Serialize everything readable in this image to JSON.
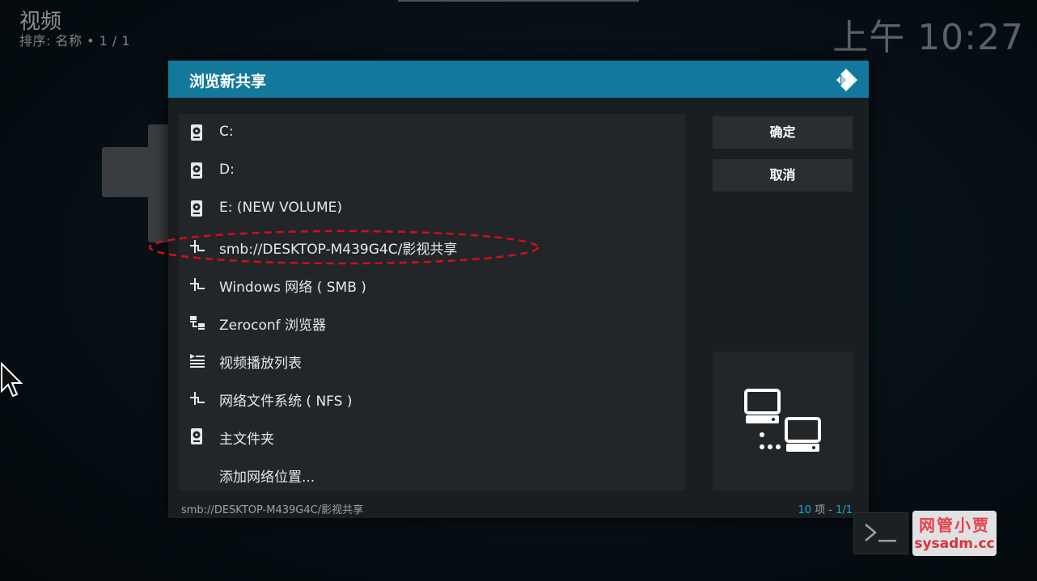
{
  "background": {
    "title": "视频",
    "subtitle": "排序: 名称  •  1 / 1",
    "clock": "上午 10:27"
  },
  "dialog": {
    "title": "浏览新共享",
    "logo_icon": "kodi-logo-icon",
    "items": [
      {
        "label": "C:",
        "icon": "harddisk-icon"
      },
      {
        "label": "D:",
        "icon": "harddisk-icon"
      },
      {
        "label": "E: (NEW VOLUME)",
        "icon": "harddisk-icon"
      },
      {
        "label": "smb://DESKTOP-M439G4C/影视共享",
        "icon": "network-icon"
      },
      {
        "label": "Windows 网络 ( SMB )",
        "icon": "network-icon"
      },
      {
        "label": "Zeroconf 浏览器",
        "icon": "network-share-icon"
      },
      {
        "label": "视频播放列表",
        "icon": "playlist-icon"
      },
      {
        "label": "网络文件系统 ( NFS )",
        "icon": "network-icon"
      },
      {
        "label": "主文件夹",
        "icon": "harddisk-icon"
      },
      {
        "label": "添加网络位置...",
        "icon": ""
      }
    ],
    "ok_label": "确定",
    "cancel_label": "取消",
    "status_path": "smb://DESKTOP-M439G4C/影视共享",
    "status_count": "10",
    "status_items_word": " 项 - ",
    "status_page": "1/1"
  },
  "watermark": {
    "line1": "网管小贾",
    "line2": "sysadm.cc"
  },
  "colors": {
    "header": "#12799c",
    "accent": "#12a8d8",
    "annotation": "#d0101a"
  }
}
